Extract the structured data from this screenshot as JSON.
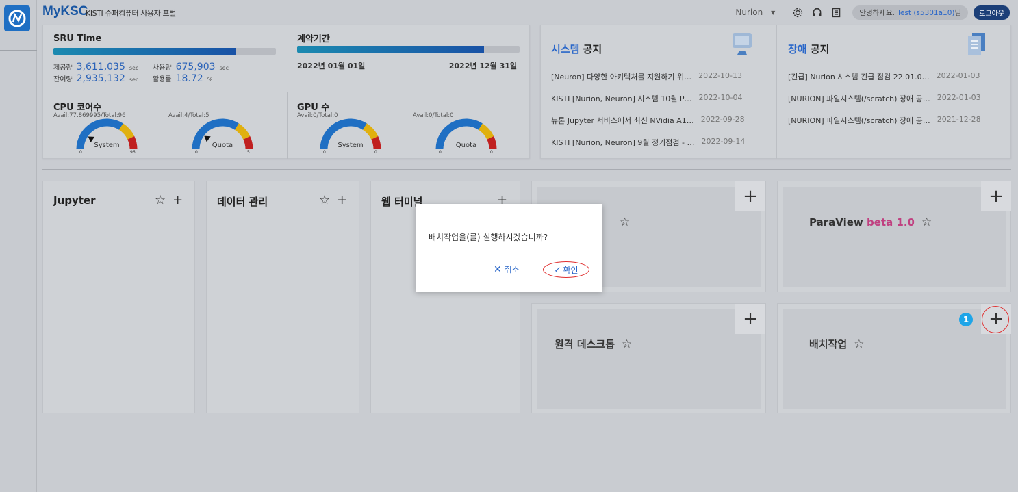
{
  "header": {
    "brand": "MyKSC",
    "subtitle": "KISTI 슈퍼컴퓨터 사용자 포털",
    "system_select": "Nurion",
    "greeting_prefix": "안녕하세요.",
    "user": "Test (s5301a10)",
    "greeting_suffix": "님",
    "logout": "로그아웃"
  },
  "sru": {
    "title": "SRU Time",
    "progress": 0.82,
    "provided_label": "제공량",
    "provided_value": "3,611,035",
    "remaining_label": "잔여량",
    "remaining_value": "2,935,132",
    "used_label": "사용량",
    "used_value": "675,903",
    "usage_rate_label": "활용률",
    "usage_rate_value": "18.72",
    "unit_sec": "sec",
    "unit_pct": "%"
  },
  "contract": {
    "title": "계약기간",
    "progress": 0.84,
    "start": "2022년 01월 01일",
    "end": "2022년 12월 31일"
  },
  "cpu": {
    "title": "CPU 코어수",
    "system": {
      "avail": "Avail:77.869995/Total:96",
      "label": "System",
      "min": "0",
      "max": "96",
      "level": 0.19
    },
    "quota": {
      "avail": "Avail:4/Total:5",
      "label": "Quota",
      "min": "0",
      "max": "5",
      "level": 0.2
    }
  },
  "gpu": {
    "title": "GPU 수",
    "system": {
      "avail": "Avail:0/Total:0",
      "label": "System",
      "min": "0",
      "max": "0"
    },
    "quota": {
      "avail": "Avail:0/Total:0",
      "label": "Quota",
      "min": "0",
      "max": "0"
    }
  },
  "system_notice": {
    "title_hl": "시스템",
    "title_rest": " 공지",
    "items": [
      {
        "text": "[Neuron] 다양한 아키텍처를 지원하기 위…",
        "date": "2022-10-13"
      },
      {
        "text": "KISTI [Nurion, Neuron] 시스템 10월 P…",
        "date": "2022-10-04"
      },
      {
        "text": "뉴론 Jupyter 서비스에서 최신 NVidia A1…",
        "date": "2022-09-28"
      },
      {
        "text": "KISTI [Nurion, Neuron] 9월 정기점검 - …",
        "date": "2022-09-14"
      }
    ]
  },
  "fault_notice": {
    "title_hl": "장애",
    "title_rest": " 공지",
    "items": [
      {
        "text": "[긴급] Nurion 시스템 긴급 점검 22.01.0…",
        "date": "2022-01-03"
      },
      {
        "text": "[NURION] 파일시스템(/scratch) 장애 공…",
        "date": "2022-01-03"
      },
      {
        "text": "[NURION] 파일시스템(/scratch) 장애 공…",
        "date": "2021-12-28"
      }
    ]
  },
  "apps": {
    "jupyter": "Jupyter",
    "data": "데이터 관리",
    "webterm": "웹 터미널",
    "paraview": "ParaView",
    "paraview_beta": "beta 1.0",
    "remote_desktop": "원격 데스크톱",
    "batch": "배치작업"
  },
  "modal": {
    "message": "배치작업을(를) 실행하시겠습니까?",
    "cancel": "취소",
    "ok": "확인"
  },
  "badge": "1",
  "colors": {
    "accent": "#2a67c9",
    "brand": "#1a57a3",
    "beta": "#c04080",
    "highlight_ring": "#e03030"
  }
}
